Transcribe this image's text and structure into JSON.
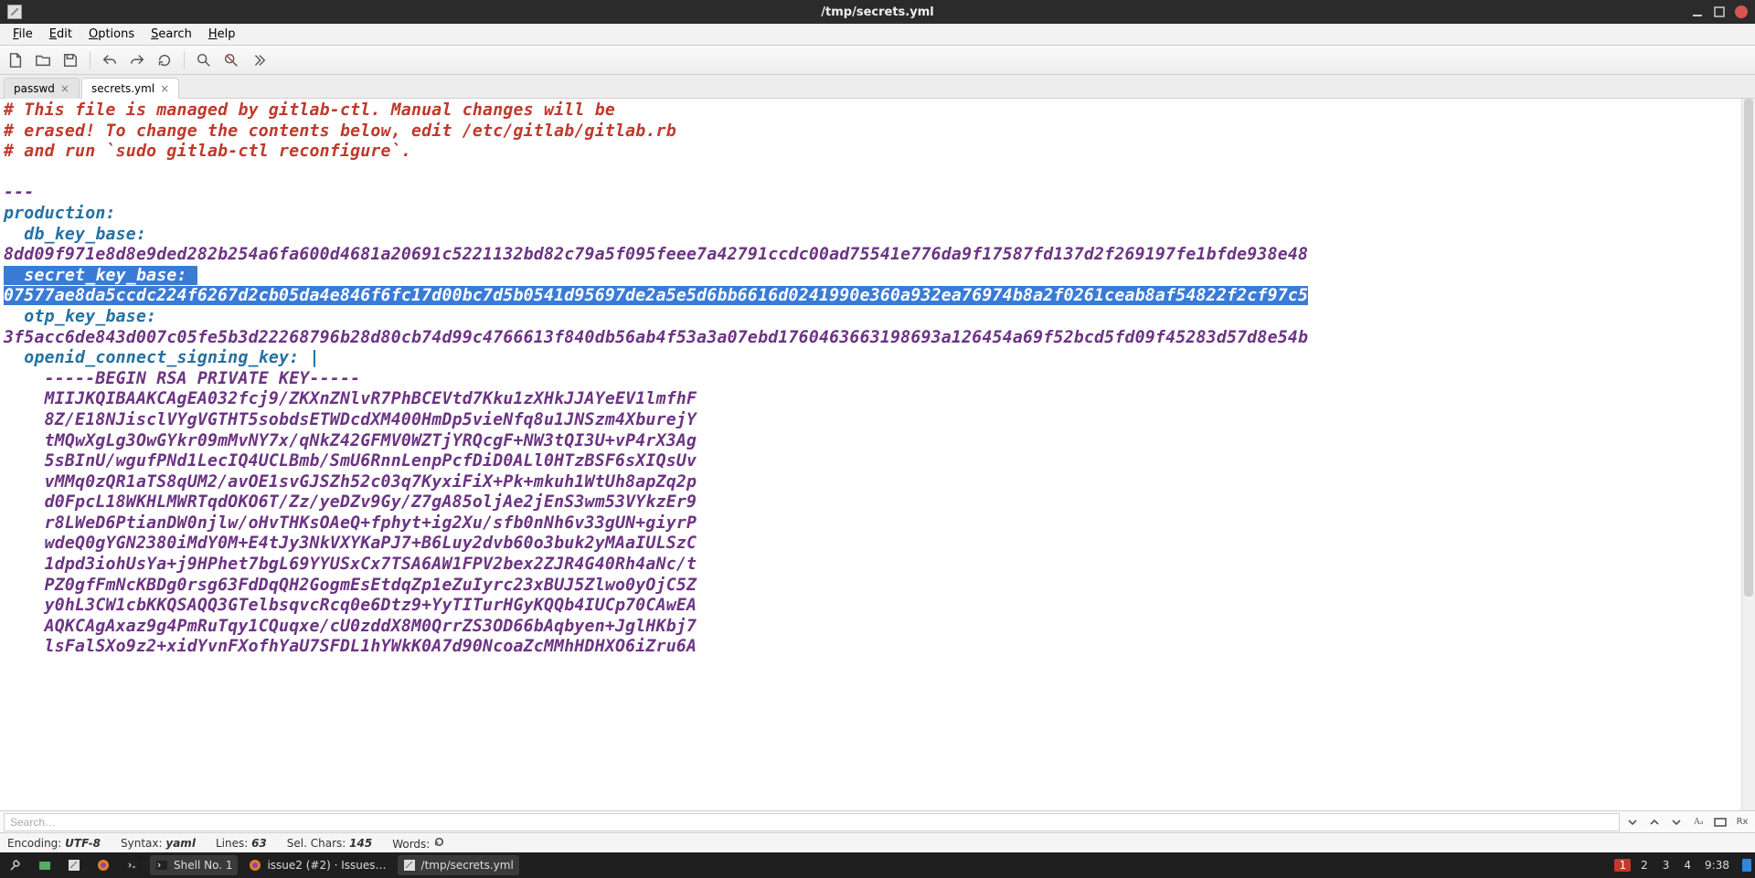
{
  "window": {
    "title": "/tmp/secrets.yml"
  },
  "menubar": [
    "File",
    "Edit",
    "Options",
    "Search",
    "Help"
  ],
  "tabs": [
    {
      "label": "passwd",
      "active": false
    },
    {
      "label": "secrets.yml",
      "active": true
    }
  ],
  "editor": {
    "comment1": "# This file is managed by gitlab-ctl. Manual changes will be",
    "comment2": "# erased! To change the contents below, edit /etc/gitlab/gitlab.rb",
    "comment3": "# and run `sudo gitlab-ctl reconfigure`.",
    "docmarker": "---",
    "k_production": "production:",
    "k_db_key_base": "  db_key_base: ",
    "v_db_key_base": "8dd09f971e8d8e9ded282b254a6fa600d4681a20691c5221132bd82c79a5f095feee7a42791ccdc00ad75541e776da9f17587fd137d2f269197fe1bfde938e48",
    "k_secret_key_base": "  secret_key_base: ",
    "v_secret_key_base": "07577ae8da5ccdc224f6267d2cb05da4e846f6fc17d00bc7d5b0541d95697de2a5e5d6bb6616d0241990e360a932ea76974b8a2f0261ceab8af54822f2cf97c5",
    "k_otp_key_base": "  otp_key_base: ",
    "v_otp_key_base": "3f5acc6de843d007c05fe5b3d22268796b28d80cb74d99c4766613f840db56ab4f53a3a07ebd1760463663198693a126454a69f52bcd5fd09f45283d57d8e54b",
    "k_openid": "  openid_connect_signing_key: ",
    "v_openid_pipe": "|",
    "rsa": [
      "    -----BEGIN RSA PRIVATE KEY-----",
      "    MIIJKQIBAAKCAgEA032fcj9/ZKXnZNlvR7PhBCEVtd7Kku1zXHkJJAYeEV1lmfhF",
      "    8Z/E18NJisclVYgVGTHT5sobdsETWDcdXM400HmDp5vieNfq8u1JNSzm4XburejY",
      "    tMQwXgLg3OwGYkr09mMvNY7x/qNkZ42GFMV0WZTjYRQcgF+NW3tQI3U+vP4rX3Ag",
      "    5sBInU/wgufPNd1LecIQ4UCLBmb/SmU6RnnLenpPcfDiD0ALl0HTzBSF6sXIQsUv",
      "    vMMq0zQR1aTS8qUM2/avOE1svGJSZh52c03q7KyxiFiX+Pk+mkuh1WtUh8apZq2p",
      "    d0FpcL18WKHLMWRTqdOKO6T/Zz/yeDZv9Gy/Z7gA85oljAe2jEnS3wm53VYkzEr9",
      "    r8LWeD6PtianDW0njlw/oHvTHKsOAeQ+fphyt+ig2Xu/sfb0nNh6v33gUN+giyrP",
      "    wdeQ0gYGN2380iMdY0M+E4tJy3NkVXYKaPJ7+B6Luy2dvb60o3buk2yMAaIULSzC",
      "    1dpd3iohUsYa+j9HPhet7bgL69YYUSxCx7TSA6AW1FPV2bex2ZJR4G40Rh4aNc/t",
      "    PZ0gfFmNcKBDg0rsg63FdDqQH2GogmEsEtdqZp1eZuIyrc23xBUJ5Zlwo0yOjC5Z",
      "    y0hL3CW1cbKKQSAQQ3GTelbsqvcRcq0e6Dtz9+YyTITurHGyKQQb4IUCp70CAwEA",
      "    AQKCAgAxaz9g4PmRuTqy1CQuqxe/cU0zddX8M0QrrZS3OD66bAqbyen+JglHKbj7",
      "    lsFalSXo9z2+xidYvnFXofhYaU7SFDL1hYWkK0A7d90NcoaZcMMhHDHXO6iZru6A"
    ]
  },
  "search": {
    "placeholder": "Search…"
  },
  "statusbar": {
    "encoding_label": "Encoding:",
    "encoding_value": "UTF-8",
    "syntax_label": "Syntax:",
    "syntax_value": "yaml",
    "lines_label": "Lines:",
    "lines_value": "63",
    "sel_label": "Sel. Chars:",
    "sel_value": "145",
    "words_label": "Words:"
  },
  "taskbar": {
    "items": [
      {
        "label": "Shell No. 1"
      },
      {
        "label": "issue2 (#2) · Issues…"
      },
      {
        "label": "/tmp/secrets.yml"
      }
    ],
    "workspaces": [
      "1",
      "2",
      "3",
      "4"
    ],
    "time": "9:38"
  }
}
